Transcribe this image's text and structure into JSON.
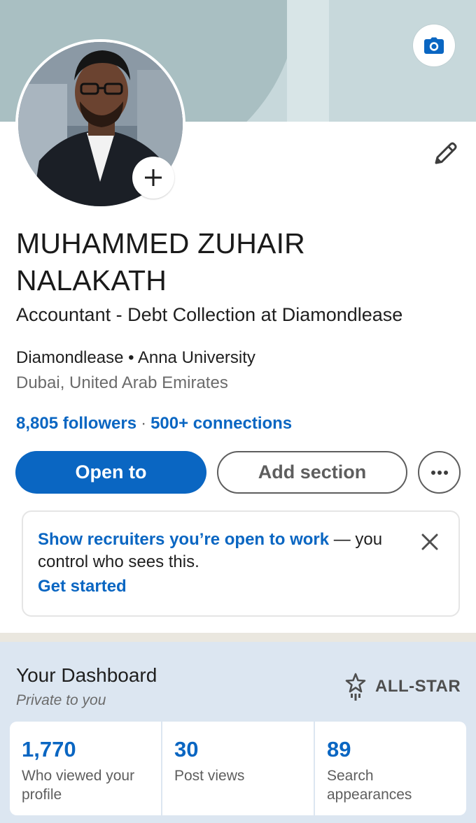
{
  "profile": {
    "name": "MUHAMMED ZUHAIR NALAKATH",
    "headline": "Accountant - Debt Collection at Diamondlease",
    "company": "Diamondlease",
    "education": "Anna University",
    "org_separator": "•",
    "location": "Dubai, United Arab Emirates",
    "followers": "8,805 followers",
    "network_separator": "·",
    "connections": "500+ connections"
  },
  "actions": {
    "open_to_label": "Open to",
    "add_section_label": "Add section",
    "more_icon": "ellipsis-icon"
  },
  "recruiter_card": {
    "lead": "Show recruiters you’re open to work",
    "rest": " — you control who sees this.",
    "link": "Get started"
  },
  "dashboard": {
    "title": "Your Dashboard",
    "subtitle": "Private to you",
    "level": "ALL-STAR",
    "stats": [
      {
        "value": "1,770",
        "label": "Who viewed your profile"
      },
      {
        "value": "30",
        "label": "Post views"
      },
      {
        "value": "89",
        "label": "Search appearances"
      }
    ]
  },
  "colors": {
    "accent": "#0a66c2",
    "dashboard_bg": "#dce6f1",
    "cover_bg": "#c7d8db"
  },
  "icons": [
    "camera-icon",
    "plus-icon",
    "pencil-icon",
    "ellipsis-icon",
    "close-icon",
    "all-star-icon"
  ]
}
